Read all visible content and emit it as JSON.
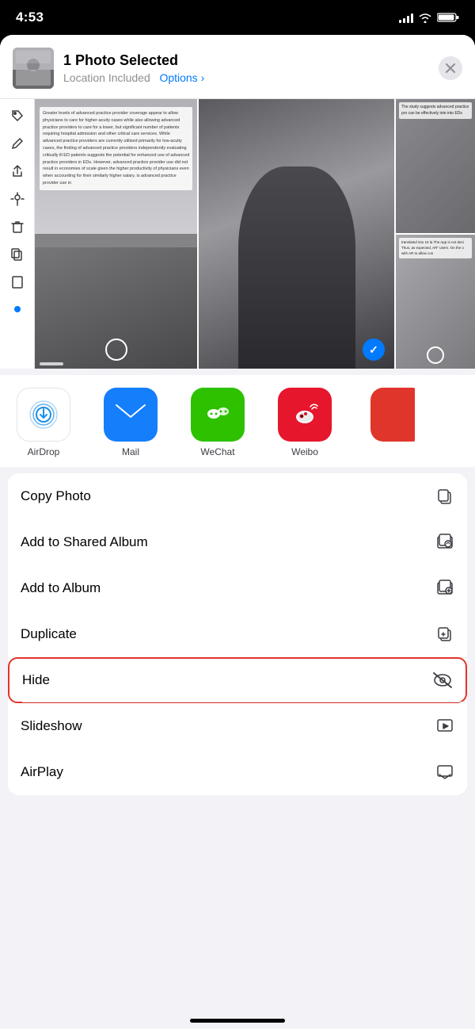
{
  "status_bar": {
    "time": "4:53",
    "signal_label": "signal",
    "wifi_label": "wifi",
    "battery_label": "battery"
  },
  "header": {
    "title": "1 Photo Selected",
    "subtitle": "Location Included",
    "options_label": "Options",
    "chevron": "›",
    "close_label": "×"
  },
  "photo_text_overlay": "Greater levels of advanced practice provider coverage appear to allow physicians to care for higher-acuity cases while also allowing advanced practice providers to care for a lower, but significant number of patients requiring hospital admission and other critical care services. While advanced practice providers are currently utilized primarily for low-acuity cases, the finding of advanced practice providers independently evaluating critically ill ED patients suggests the potential for enhanced use of advanced practice providers in EDs. However, advanced practice provider use did not result in economies of scale given the higher productivity of physicians even when accounting for their similarly higher salary. is advanced practice provider use in",
  "right_text_overlay": "The study suggests advanced practice pro can be effectively inte into EDs",
  "right_text_overlay2": "translated into 15 la The App is not desi Thus, as expected, AR\" users. On the o with AR to allow con",
  "apps": [
    {
      "id": "airdrop",
      "label": "AirDrop",
      "icon_type": "airdrop"
    },
    {
      "id": "mail",
      "label": "Mail",
      "icon_type": "mail"
    },
    {
      "id": "wechat",
      "label": "WeChat",
      "icon_type": "wechat"
    },
    {
      "id": "weibo",
      "label": "Weibo",
      "icon_type": "weibo"
    }
  ],
  "actions": [
    {
      "id": "copy-photo",
      "label": "Copy Photo",
      "icon": "copy"
    },
    {
      "id": "add-shared-album",
      "label": "Add to Shared Album",
      "icon": "shared-album"
    },
    {
      "id": "add-album",
      "label": "Add to Album",
      "icon": "add-album"
    },
    {
      "id": "duplicate",
      "label": "Duplicate",
      "icon": "duplicate"
    },
    {
      "id": "hide",
      "label": "Hide",
      "icon": "hide",
      "highlighted": true
    },
    {
      "id": "slideshow",
      "label": "Slideshow",
      "icon": "slideshow"
    },
    {
      "id": "airplay",
      "label": "AirPlay",
      "icon": "airplay"
    }
  ]
}
